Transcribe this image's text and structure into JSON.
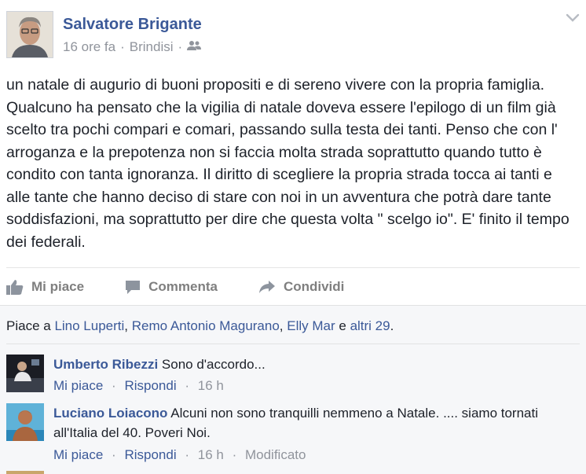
{
  "post": {
    "author": "Salvatore Brigante",
    "time": "16 ore fa",
    "location": "Brindisi",
    "audience_icon": "friends-icon",
    "body": "un natale di augurio di buoni propositi e di sereno vivere con la propria famiglia. Qualcuno ha pensato che la vigilia di natale doveva essere l'epilogo di un film già scelto tra pochi compari e comari, passando sulla testa dei tanti. Penso che con l' arroganza e la prepotenza non si faccia molta strada soprattutto quando tutto è condito con tanta ignoranza. Il diritto di scegliere la propria strada tocca ai tanti e alle tante che hanno deciso di stare con noi in un avventura che potrà dare tante soddisfazioni, ma soprattutto per dire che questa volta \" scelgo io\". E' finito il tempo dei federali."
  },
  "actions": {
    "like": "Mi piace",
    "comment": "Commenta",
    "share": "Condividi"
  },
  "likes": {
    "prefix": "Piace a ",
    "names": [
      "Lino Luperti",
      "Remo Antonio Magurano",
      "Elly Mar"
    ],
    "sep1": ", ",
    "sep2": ", ",
    "conj": " e ",
    "others": "altri 29",
    "suffix": "."
  },
  "comments": [
    {
      "name": "Umberto Ribezzi",
      "text": "Sono d'accordo...",
      "like": "Mi piace",
      "reply": "Rispondi",
      "time": "16 h",
      "edited": ""
    },
    {
      "name": "Luciano Loiacono",
      "text": "Alcuni non sono tranquilli nemmeno a Natale. .... siamo tornati all'Italia del 40. Poveri Noi.",
      "like": "Mi piace",
      "reply": "Rispondi",
      "time": "16 h",
      "edited": "Modificato"
    }
  ],
  "colors": {
    "link": "#3b5998",
    "muted": "#90949c",
    "text": "#1d2129",
    "panel": "#f6f7f9"
  }
}
